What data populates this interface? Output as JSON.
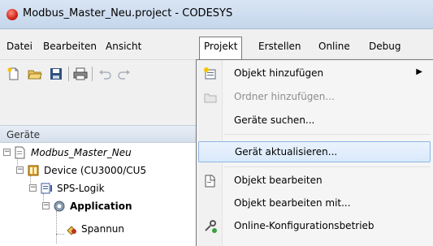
{
  "window": {
    "title": "Modbus_Master_Neu.project - CODESYS"
  },
  "menubar": {
    "items": [
      {
        "label": "Datei"
      },
      {
        "label": "Bearbeiten"
      },
      {
        "label": "Ansicht"
      },
      {
        "label": "Projekt"
      },
      {
        "label": "Erstellen"
      },
      {
        "label": "Online"
      },
      {
        "label": "Debug"
      }
    ],
    "active": "Projekt"
  },
  "toolbar": {
    "buttons": [
      "new-file-icon",
      "open-folder-icon",
      "save-icon",
      "print-icon",
      "undo-icon",
      "redo-icon"
    ]
  },
  "devices_panel": {
    "title": "Geräte",
    "tree": [
      {
        "label": "Modbus_Master_Neu",
        "icon": "project-icon"
      },
      {
        "label": "Device (CU3000/CU5",
        "icon": "device-icon"
      },
      {
        "label": "SPS-Logik",
        "icon": "plc-logic-icon"
      },
      {
        "label": "Application",
        "icon": "application-icon"
      },
      {
        "label": "Spannun",
        "icon": "pou-icon"
      }
    ]
  },
  "context_menu": {
    "items": [
      {
        "label": "Objekt hinzufügen",
        "icon": "add-object-icon",
        "submenu": true,
        "disabled": false
      },
      {
        "label": "Ordner hinzufügen...",
        "icon": "folder-icon",
        "disabled": true
      },
      {
        "label": "Geräte suchen...",
        "icon": "",
        "disabled": false
      },
      {
        "label": "Gerät aktualisieren...",
        "icon": "",
        "disabled": false,
        "highlighted": true
      },
      {
        "label": "Objekt bearbeiten",
        "icon": "edit-object-icon",
        "disabled": false
      },
      {
        "label": "Objekt bearbeiten mit...",
        "icon": "",
        "disabled": false
      },
      {
        "label": "Online-Konfigurationsbetrieb",
        "icon": "online-config-icon",
        "disabled": false
      }
    ]
  },
  "colors": {
    "highlight_border": "#8fb6e3",
    "highlight_fill": "#d9e9fb",
    "title_gradient_top": "#d9e5f3"
  }
}
